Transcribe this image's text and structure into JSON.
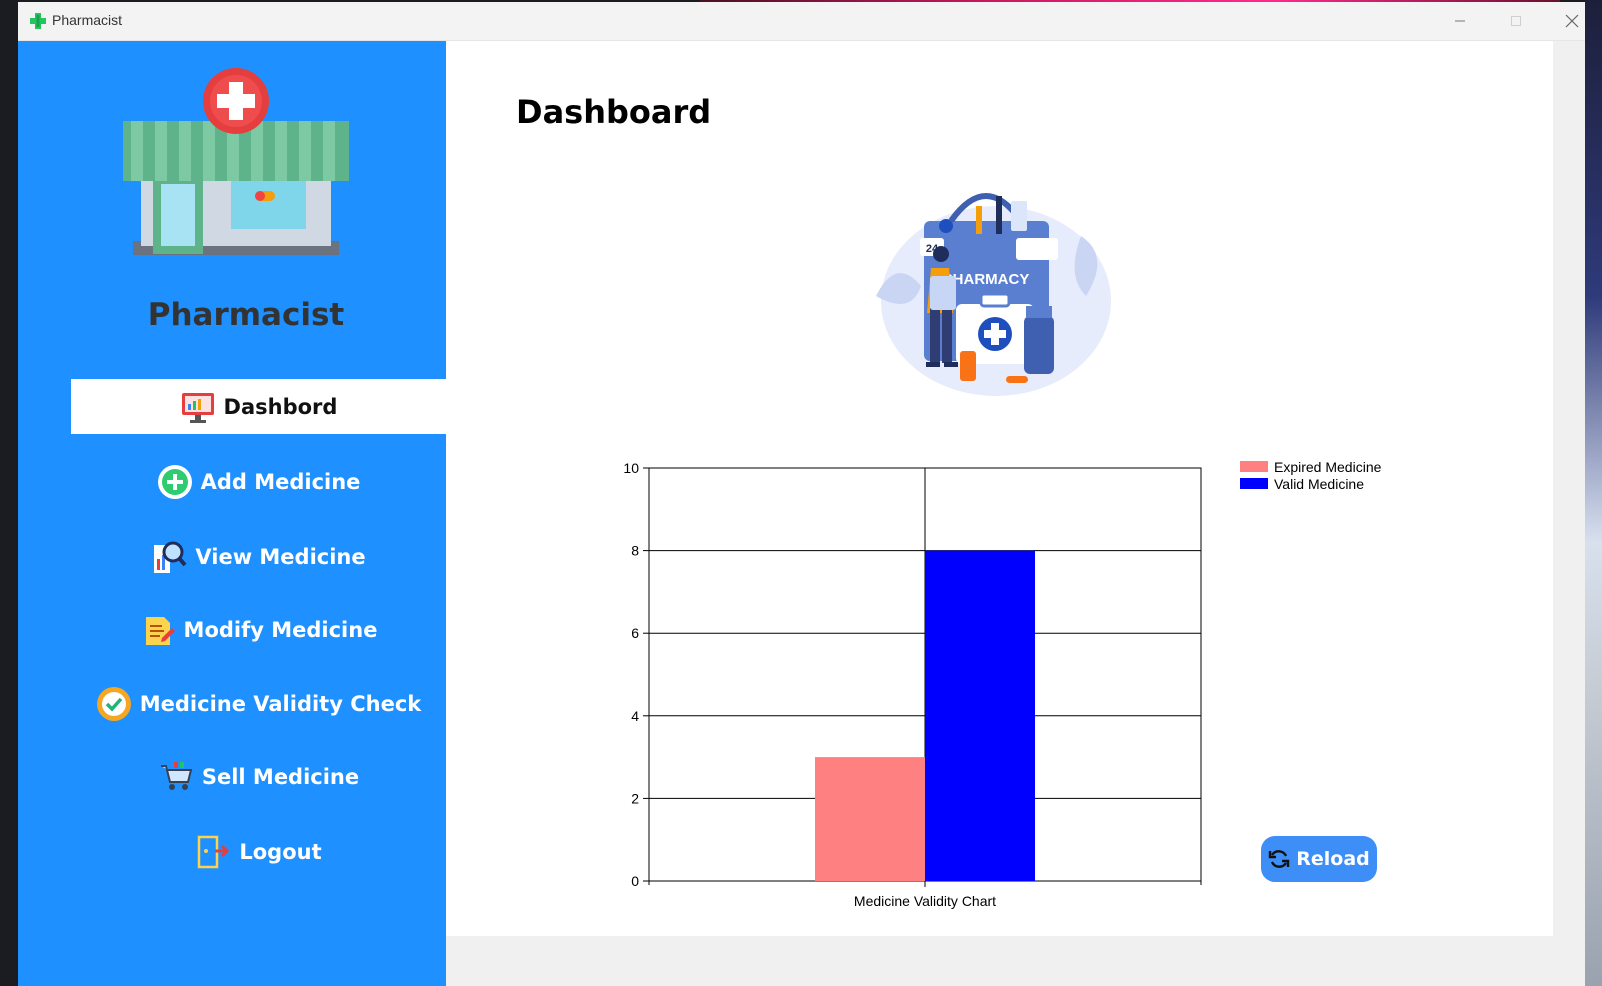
{
  "window": {
    "title": "Pharmacist",
    "controls": {
      "minimize": "—",
      "maximize": "☐",
      "close": "✕"
    }
  },
  "sidebar": {
    "brand_title": "Pharmacist",
    "nav": [
      {
        "label": "Dashbord",
        "icon": "dashboard-monitor-icon",
        "active": true
      },
      {
        "label": "Add Medicine",
        "icon": "add-plus-icon",
        "active": false
      },
      {
        "label": "View Medicine",
        "icon": "view-magnifier-icon",
        "active": false
      },
      {
        "label": "Modify Medicine",
        "icon": "edit-note-icon",
        "active": false
      },
      {
        "label": "Medicine Validity Check",
        "icon": "check-badge-icon",
        "active": false
      },
      {
        "label": "Sell Medicine",
        "icon": "shopping-cart-icon",
        "active": false
      },
      {
        "label": "Logout",
        "icon": "logout-door-icon",
        "active": false
      }
    ]
  },
  "main": {
    "page_title": "Dashboard",
    "hero_sign_text": "PHARMACY",
    "hero_badge_text": "24",
    "reload_label": "Reload"
  },
  "colors": {
    "sidebar_bg": "#1e90ff",
    "expired": "#ff8080",
    "valid": "#0000ff",
    "reload_bg": "#3d8ef6"
  },
  "chart_data": {
    "type": "bar",
    "categories": [
      "Medicine Validity Chart"
    ],
    "series": [
      {
        "name": "Expired Medicine",
        "values": [
          3
        ],
        "color": "#ff8080"
      },
      {
        "name": "Valid Medicine",
        "values": [
          8
        ],
        "color": "#0000ff"
      }
    ],
    "ylim": [
      0,
      10
    ],
    "yticks": [
      0,
      2,
      4,
      6,
      8,
      10
    ],
    "grid": true,
    "legend": "top-right"
  }
}
